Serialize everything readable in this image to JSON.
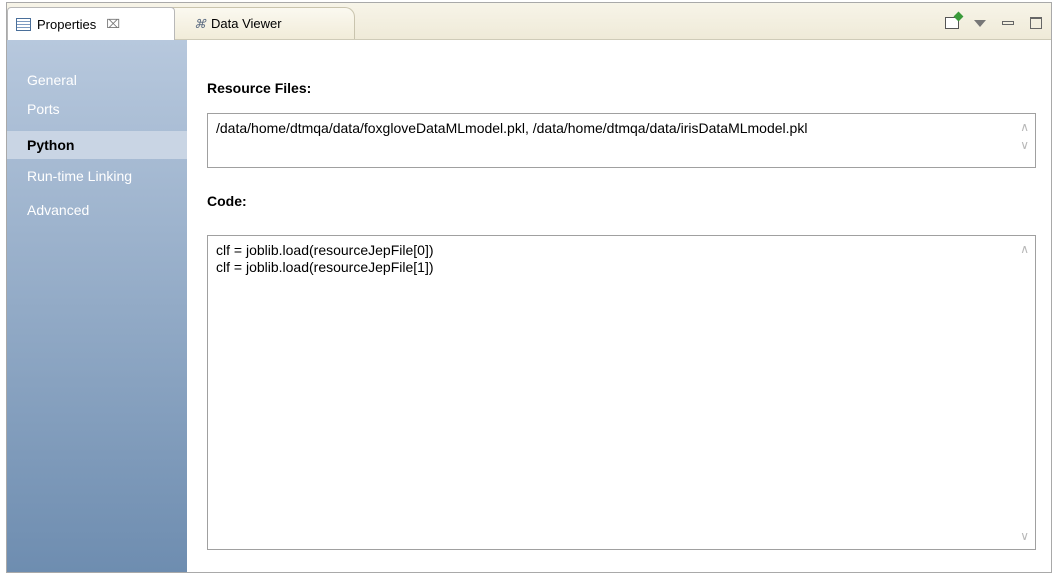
{
  "tabs": [
    {
      "label": "Properties",
      "close": "⌧"
    },
    {
      "label": "Data Viewer"
    }
  ],
  "sidebar": {
    "items": [
      {
        "label": "General"
      },
      {
        "label": "Ports"
      },
      {
        "label": "Python"
      },
      {
        "label": "Run-time Linking"
      },
      {
        "label": "Advanced"
      }
    ]
  },
  "main": {
    "resource_files_label": "Resource Files:",
    "resource_files_value": "/data/home/dtmqa/data/foxgloveDataMLmodel.pkl, /data/home/dtmqa/data/irisDataMLmodel.pkl",
    "code_label": "Code:",
    "code_lines": [
      "clf = joblib.load(resourceJepFile[0])",
      "clf = joblib.load(resourceJepFile[1])"
    ]
  },
  "icons": {
    "properties": "properties-icon",
    "data_viewer": "data-viewer-icon",
    "open_window": "open-window-icon",
    "view_menu": "view-menu-icon",
    "minimize": "minimize-icon",
    "maximize": "maximize-icon"
  }
}
